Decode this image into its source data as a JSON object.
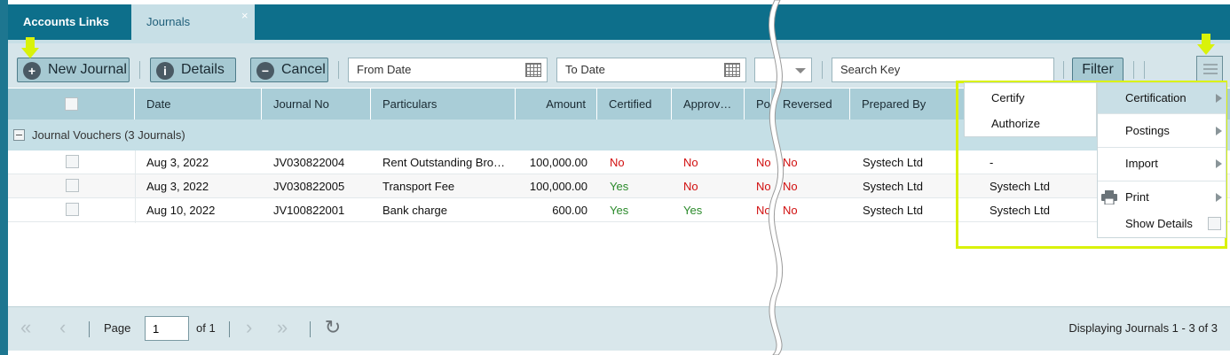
{
  "tabs": [
    {
      "label": "Accounts Links"
    },
    {
      "label": "Journals"
    }
  ],
  "tab_close_glyph": "×",
  "toolbar": {
    "new_journal": "New Journal",
    "details": "Details",
    "cancel": "Cancel",
    "from_date_placeholder": "From Date",
    "to_date_placeholder": "To Date",
    "search_placeholder": "Search Key",
    "filter": "Filter"
  },
  "columns": {
    "date": "Date",
    "journal_no": "Journal No",
    "particulars": "Particulars",
    "amount": "Amount",
    "certified": "Certified",
    "approved": "Approv…",
    "posted": "Post",
    "reversed": "Reversed",
    "prepared_by": "Prepared By"
  },
  "group": {
    "label": "Journal Vouchers (3 Journals)"
  },
  "rows": [
    {
      "date": "Aug 3, 2022",
      "journal_no": "JV030822004",
      "particulars": "Rent Outstanding Bro…",
      "amount": "100,000.00",
      "certified": "No",
      "approved": "No",
      "posted": "No",
      "reversed": "No",
      "prepared_by": "Systech Ltd",
      "certified_by": "-"
    },
    {
      "date": "Aug 3, 2022",
      "journal_no": "JV030822005",
      "particulars": "Transport Fee",
      "amount": "100,000.00",
      "certified": "Yes",
      "approved": "No",
      "posted": "No",
      "reversed": "No",
      "prepared_by": "Systech Ltd",
      "certified_by": "Systech Ltd"
    },
    {
      "date": "Aug 10, 2022",
      "journal_no": "JV100822001",
      "particulars": "Bank charge",
      "amount": "600.00",
      "certified": "Yes",
      "approved": "Yes",
      "posted": "No",
      "reversed": "No",
      "prepared_by": "Systech Ltd",
      "certified_by": "Systech Ltd"
    }
  ],
  "pager": {
    "page_label": "Page",
    "page_value": "1",
    "of_label": "of 1",
    "display": "Displaying Journals 1 - 3 of 3"
  },
  "menu": {
    "items": [
      {
        "label": "Certification"
      },
      {
        "label": "Postings"
      },
      {
        "label": "Import"
      },
      {
        "label": "Print"
      },
      {
        "label": "Show Details"
      }
    ],
    "submenu": [
      {
        "label": "Certify"
      },
      {
        "label": "Authorize"
      }
    ]
  },
  "colors": {
    "tab_bar": "#0d6f8b",
    "header": "#a9cdd7",
    "yes": "#2a8a2a",
    "no": "#d10f0f",
    "highlight": "#d9f20a"
  },
  "icons": [
    "plus-circle-icon",
    "info-circle-icon",
    "minus-circle-icon",
    "calendar-icon",
    "chevron-down-icon",
    "hamburger-menu-icon",
    "first-page-icon",
    "previous-page-icon",
    "next-page-icon",
    "last-page-icon",
    "refresh-icon",
    "printer-icon",
    "submenu-arrow-icon"
  ]
}
